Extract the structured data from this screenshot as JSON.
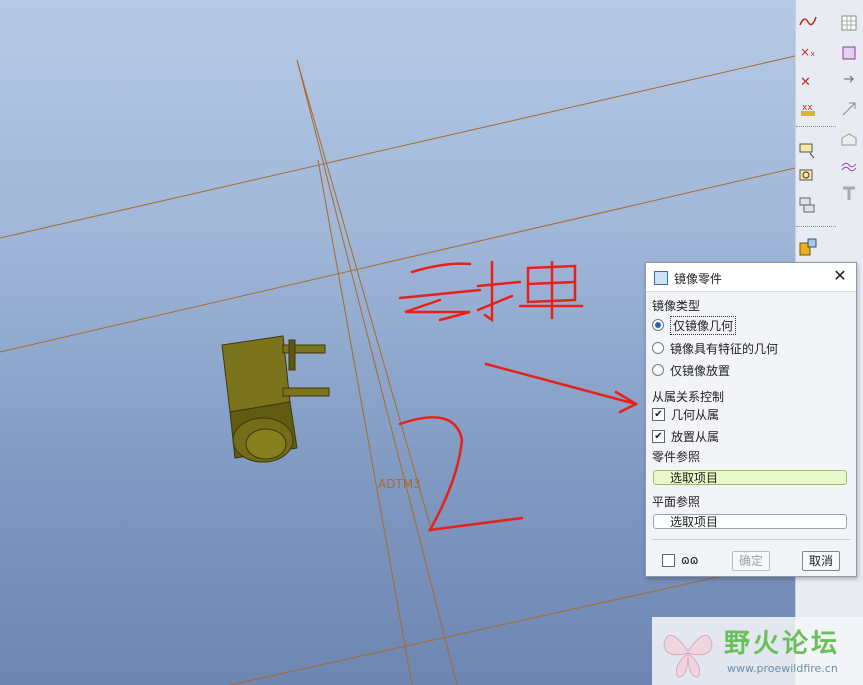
{
  "viewport": {
    "datum_label": "ADTM3",
    "annotation": "去掉",
    "annotation_number": "2",
    "colors": {
      "datum": "#a86a2c",
      "part": "#6a6315",
      "ink": "#e8201a"
    }
  },
  "toolbar": {
    "icons": [
      "sketch-curve-icon",
      "wave-curve-icon",
      "datum-point-icon",
      "datum-point-offset-icon",
      "datum-point-field-icon",
      "csys-icon",
      "axis-icon",
      "plane-icon",
      "feature-icon",
      "measure-icon",
      "grid-icon",
      "rect-select-icon",
      "arrow-icon",
      "offset-icon",
      "shell-icon",
      "surface-icon",
      "trim-icon"
    ]
  },
  "dialog": {
    "title": "镜像零件",
    "mirror_type": {
      "label": "镜像类型",
      "options": [
        "仅镜像几何",
        "镜像具有特征的几何",
        "仅镜像放置"
      ],
      "selected": 0
    },
    "dependency": {
      "label": "从属关系控制",
      "options": [
        "几何从属",
        "放置从属"
      ],
      "checked": [
        true,
        true
      ]
    },
    "part_ref": {
      "label": "零件参照",
      "value": "选取项目"
    },
    "plane_ref": {
      "label": "平面参照",
      "value": "选取项目"
    },
    "ok_label": "确定",
    "cancel_label": "取消"
  },
  "watermark": {
    "name": "野火论坛",
    "url": "www.proewildfire.cn"
  }
}
